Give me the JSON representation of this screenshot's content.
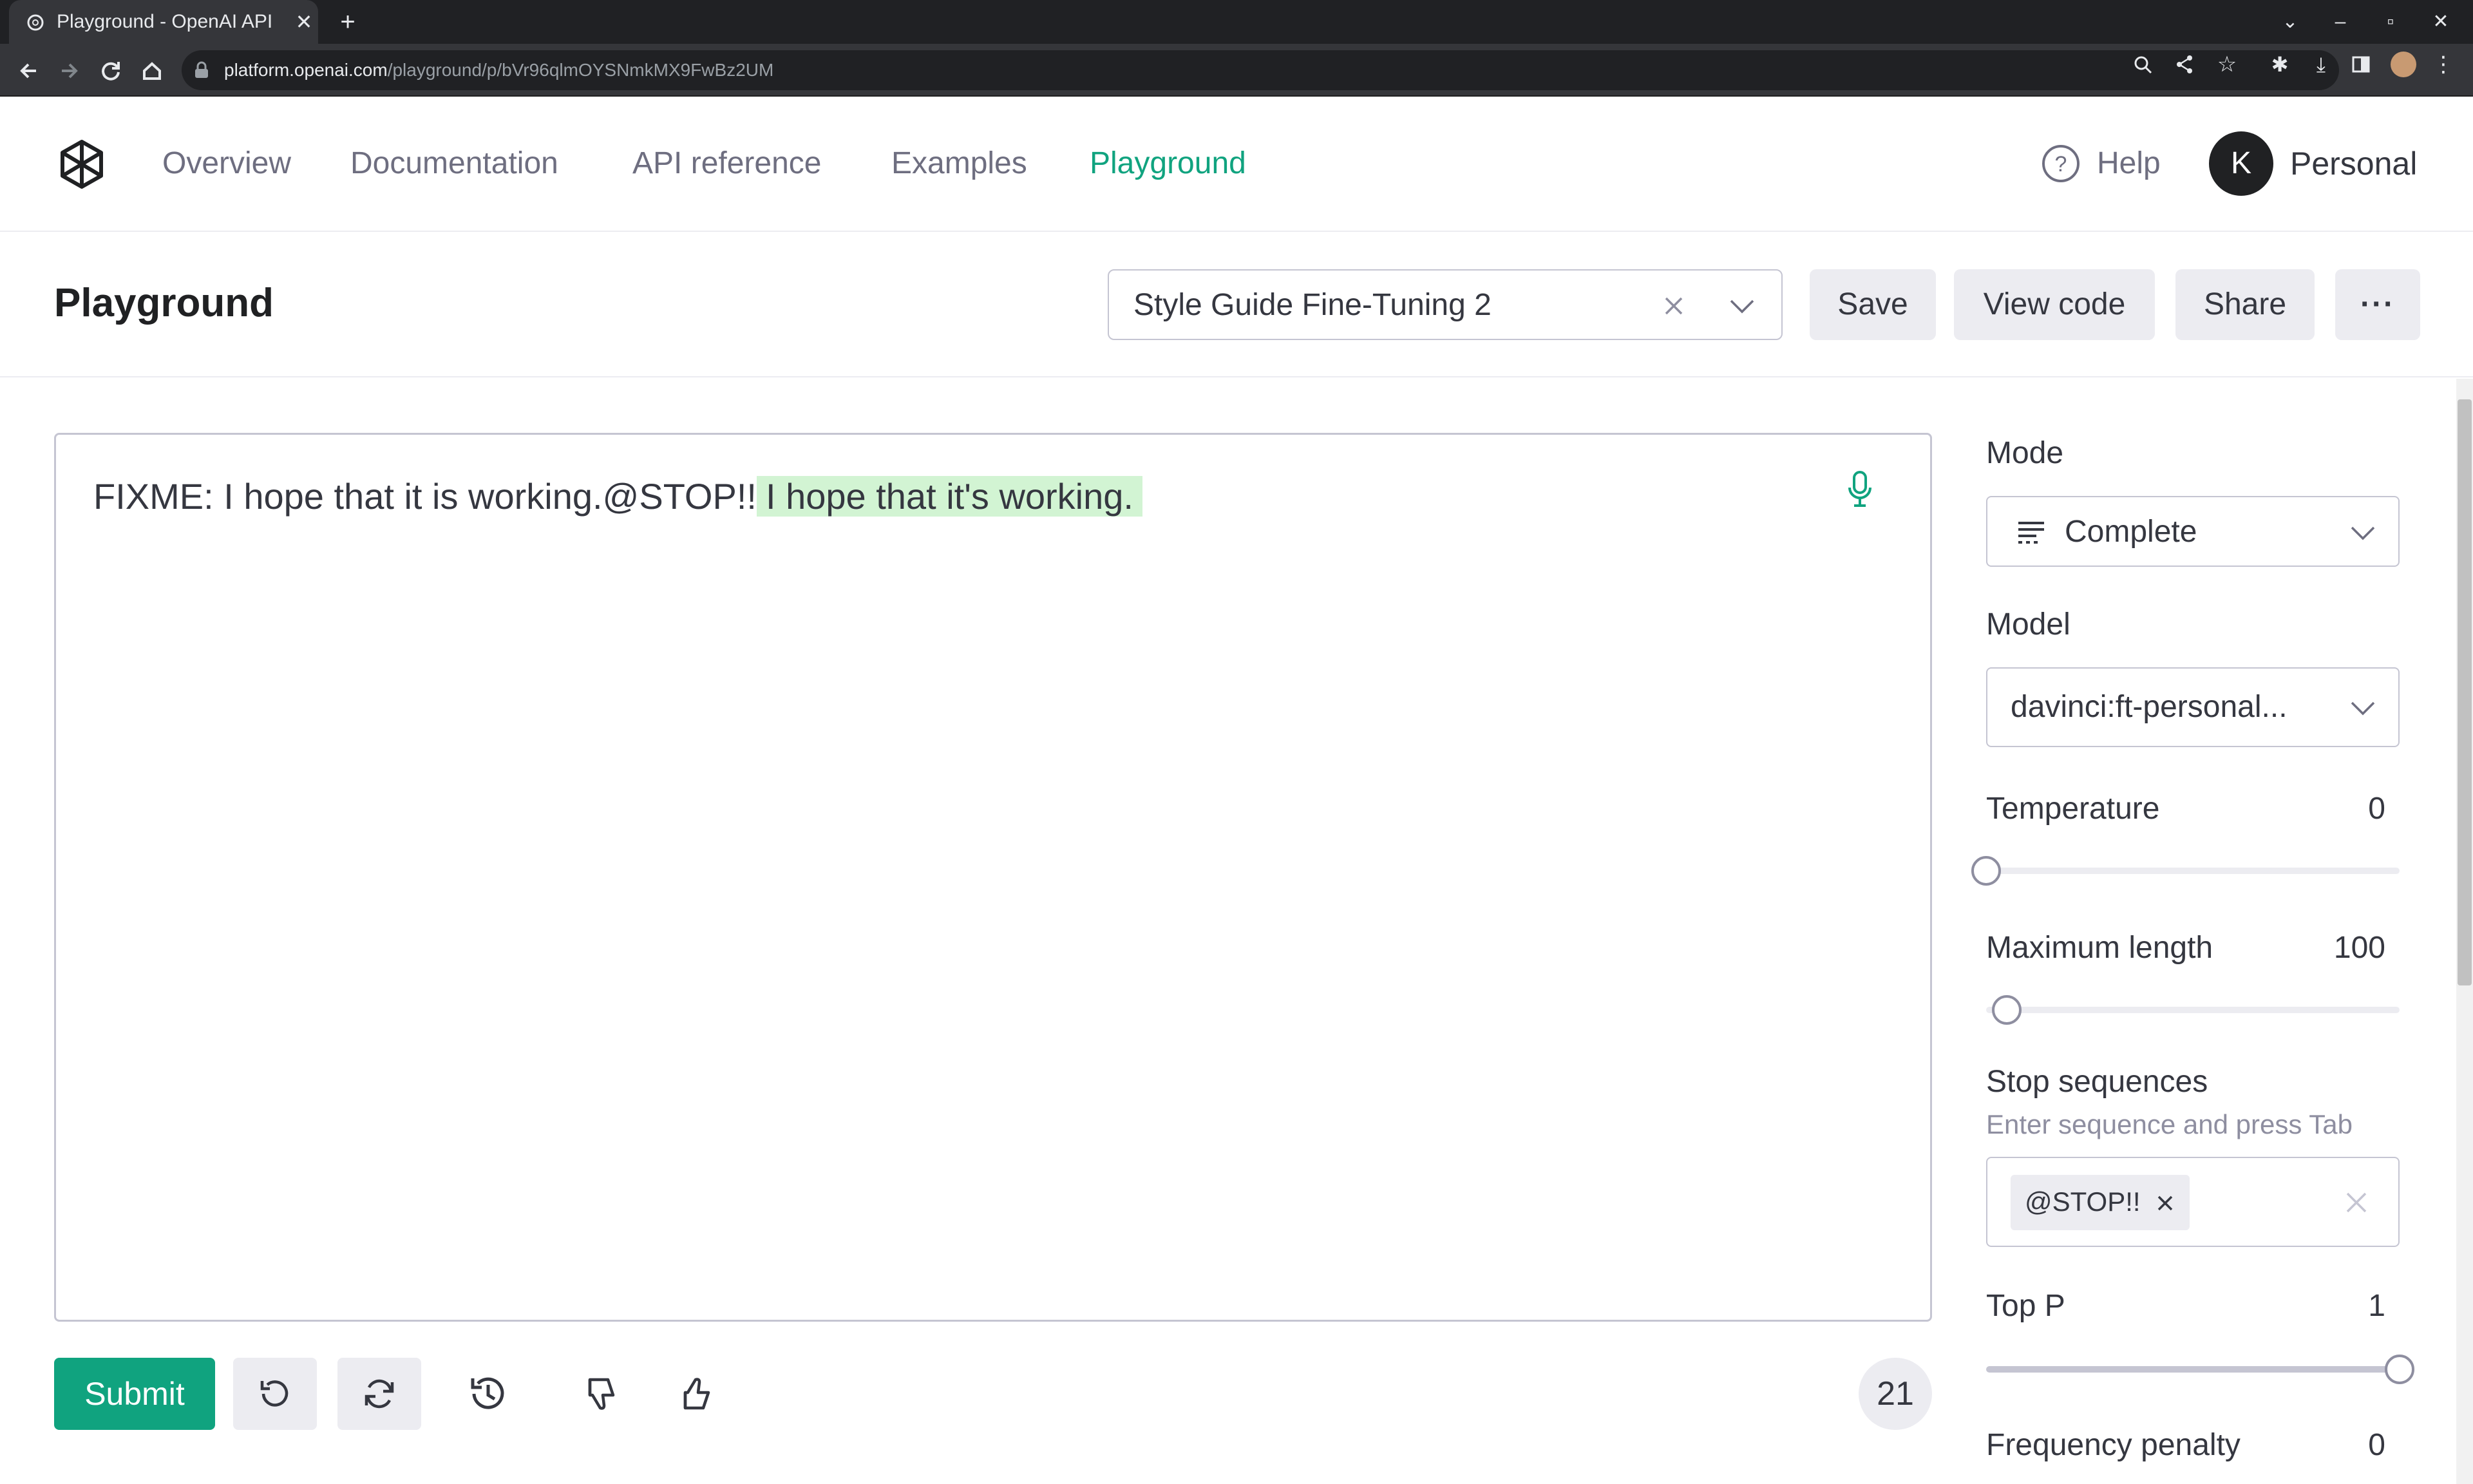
{
  "browser": {
    "tab_title": "Playground - OpenAI API",
    "new_tab": "+",
    "url_host": "platform.openai.com",
    "url_path": "/playground/p/bVr96qlmOYSNmkMX9FwBz2UM"
  },
  "nav": {
    "links": [
      "Overview",
      "Documentation",
      "API reference",
      "Examples",
      "Playground"
    ],
    "active": "Playground",
    "help_label": "Help",
    "avatar_initial": "K",
    "account_label": "Personal"
  },
  "header": {
    "title": "Playground",
    "preset_value": "Style Guide Fine-Tuning 2",
    "save_label": "Save",
    "view_code_label": "View code",
    "share_label": "Share",
    "more_label": "···"
  },
  "editor": {
    "prompt_text": "FIXME: I hope that it is working.@STOP!!",
    "completion_text": "I hope that it's working."
  },
  "footer": {
    "submit_label": "Submit",
    "token_count": "21"
  },
  "settings": {
    "mode_label": "Mode",
    "mode_value": "Complete",
    "model_label": "Model",
    "model_value": "davinci:ft-personal...",
    "temperature_label": "Temperature",
    "temperature_value": "0",
    "temperature_fraction": 0,
    "max_length_label": "Maximum length",
    "max_length_value": "100",
    "max_length_fraction": 0.05,
    "stop_label": "Stop sequences",
    "stop_hint": "Enter sequence and press Tab",
    "stop_tokens": [
      "@STOP!!"
    ],
    "top_p_label": "Top P",
    "top_p_value": "1",
    "top_p_fraction": 1,
    "freq_penalty_label": "Frequency penalty",
    "freq_penalty_value": "0"
  },
  "colors": {
    "accent": "#10a37f",
    "highlight": "#d2f4d3"
  }
}
